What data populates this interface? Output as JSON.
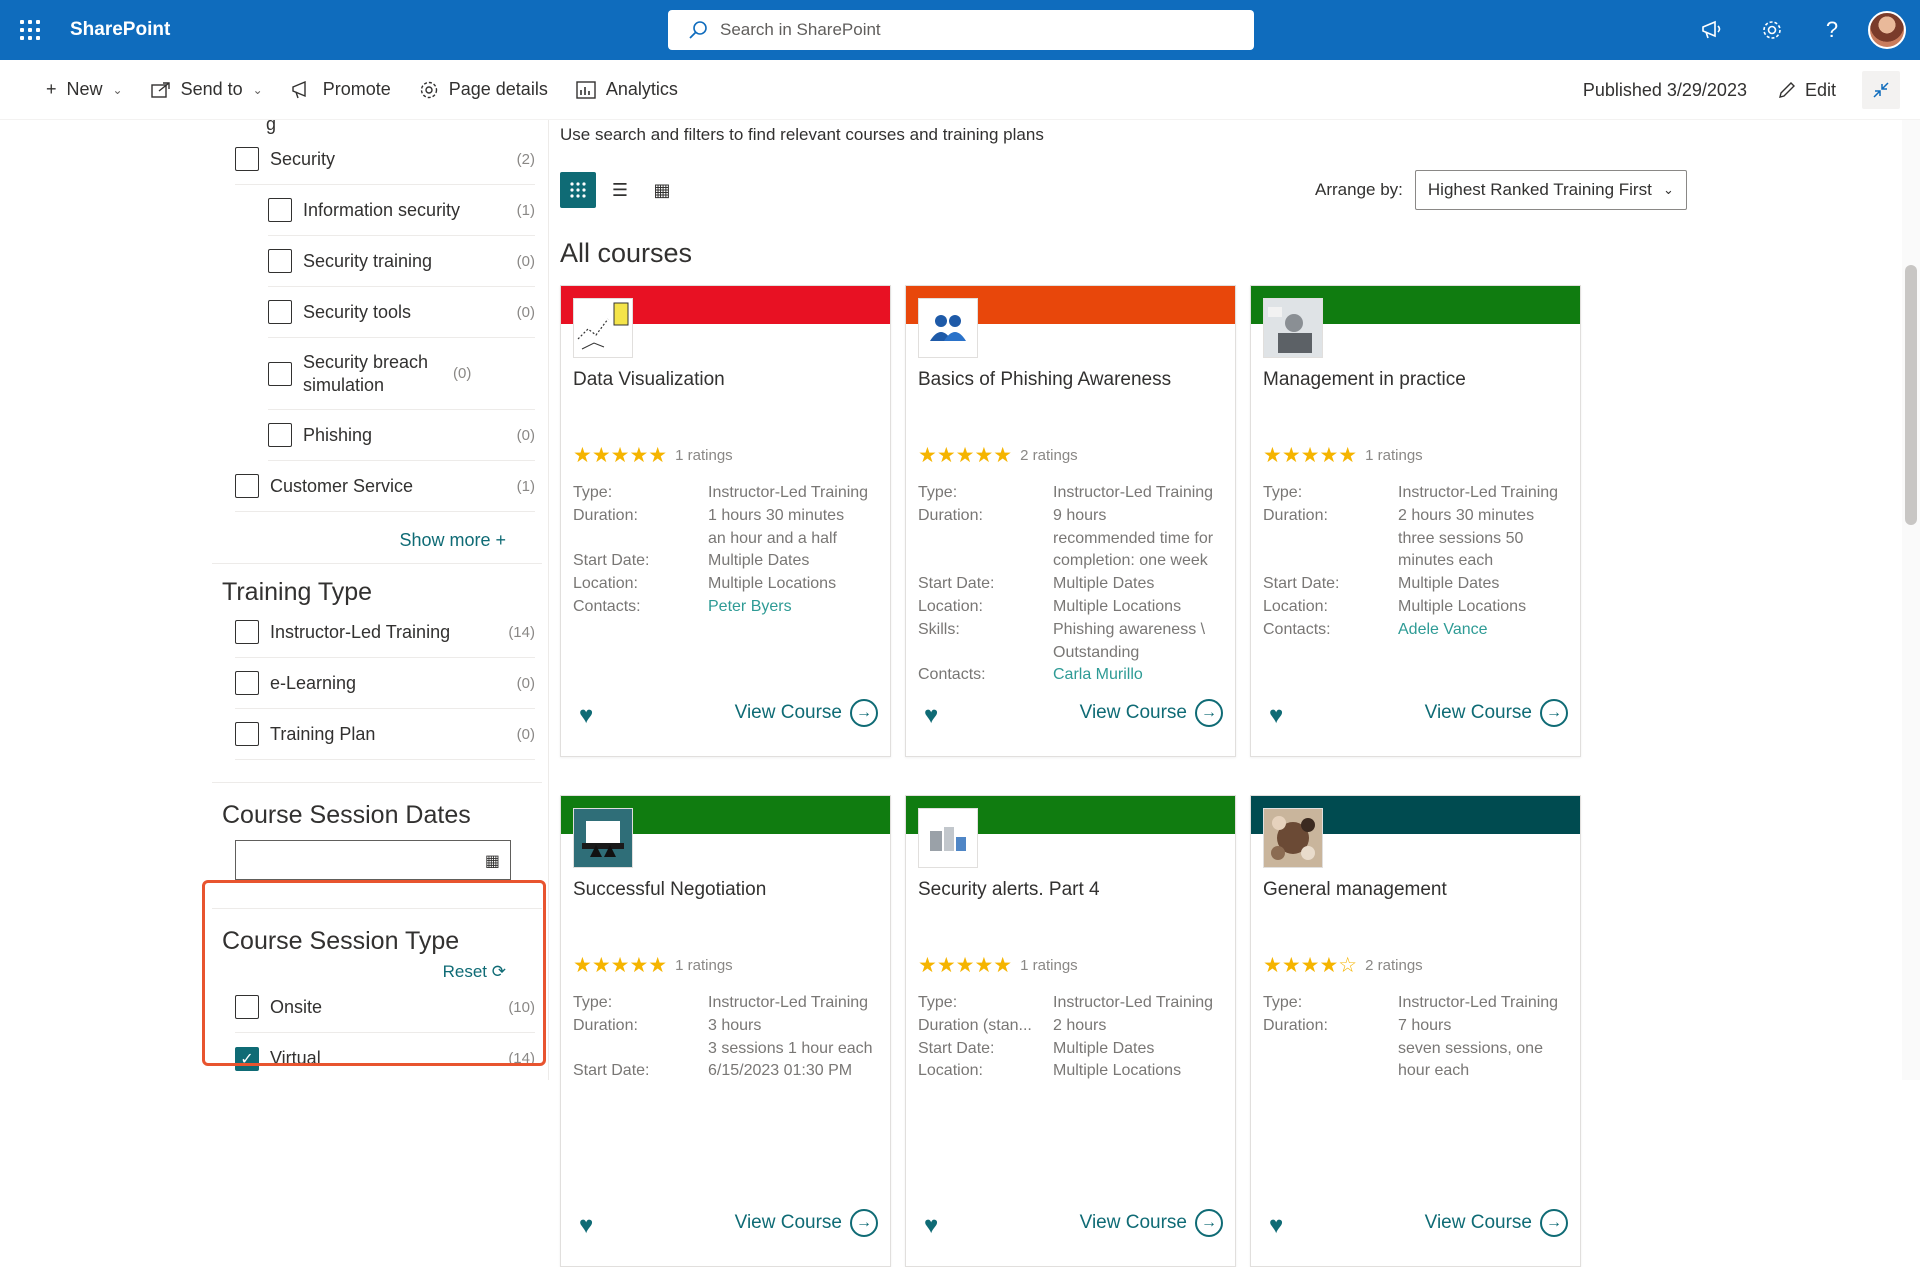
{
  "suite": {
    "app_name": "SharePoint",
    "search_placeholder": "Search in SharePoint"
  },
  "command_bar": {
    "new": "New",
    "send_to": "Send to",
    "promote": "Promote",
    "page_details": "Page details",
    "analytics": "Analytics",
    "published": "Published 3/29/2023",
    "edit": "Edit"
  },
  "filters": {
    "partial_top_header": "g",
    "category_items": [
      {
        "label": "Security",
        "count": "(2)",
        "level": 0
      },
      {
        "label": "Information security",
        "count": "(1)",
        "level": 1
      },
      {
        "label": "Security training",
        "count": "(0)",
        "level": 1
      },
      {
        "label": "Security tools",
        "count": "(0)",
        "level": 1
      },
      {
        "label": "Security breach simulation",
        "count": "(0)",
        "level": 1
      },
      {
        "label": "Phishing",
        "count": "(0)",
        "level": 1
      },
      {
        "label": "Customer Service",
        "count": "(1)",
        "level": 0
      }
    ],
    "show_more": "Show more",
    "training_type": {
      "header": "Training Type",
      "items": [
        {
          "label": "Instructor-Led Training",
          "count": "(14)"
        },
        {
          "label": "e-Learning",
          "count": "(0)"
        },
        {
          "label": "Training Plan",
          "count": "(0)"
        }
      ]
    },
    "session_dates": {
      "header": "Course Session Dates",
      "value": ""
    },
    "session_type": {
      "header": "Course Session Type",
      "reset": "Reset",
      "items": [
        {
          "label": "Onsite",
          "count": "(10)",
          "checked": false
        },
        {
          "label": "Virtual",
          "count": "(14)",
          "checked": true
        }
      ]
    }
  },
  "main": {
    "intro": "Use search and filters to find relevant courses and training plans",
    "arrange_label": "Arrange by:",
    "arrange_value": "Highest Ranked Training First",
    "section_title": "All courses",
    "view_course_label": "View Course",
    "courses": [
      {
        "title": "Data Visualization",
        "band_color": "#e81123",
        "thumb_icon": "data-visualization-thumbnail",
        "stars": "★★★★★",
        "rating_text": "1 ratings",
        "meta": [
          {
            "k": "Type:",
            "v": "Instructor-Led Training"
          },
          {
            "k": "Duration:",
            "v": "1 hours 30 minutes"
          },
          {
            "k": "",
            "v": "an hour and a half"
          },
          {
            "k": "Start Date:",
            "v": "Multiple Dates"
          },
          {
            "k": "Location:",
            "v": "Multiple Locations"
          },
          {
            "k": "Contacts:",
            "v": "Peter Byers",
            "link": true
          }
        ]
      },
      {
        "title": "Basics of Phishing Awareness",
        "band_color": "#e8470b",
        "thumb_icon": "people-icon",
        "stars": "★★★★★",
        "rating_text": "2 ratings",
        "meta": [
          {
            "k": "Type:",
            "v": "Instructor-Led Training"
          },
          {
            "k": "Duration:",
            "v": "9 hours"
          },
          {
            "k": "",
            "v": "recommended time for"
          },
          {
            "k": "",
            "v": "completion: one week"
          },
          {
            "k": "Start Date:",
            "v": "Multiple Dates"
          },
          {
            "k": "Location:",
            "v": "Multiple Locations"
          },
          {
            "k": "Skills:",
            "v": "Phishing awareness \\"
          },
          {
            "k": "",
            "v": "Outstanding"
          },
          {
            "k": "Contacts:",
            "v": "Carla Murillo",
            "link": true
          }
        ]
      },
      {
        "title": "Management in practice",
        "band_color": "#107c10",
        "thumb_icon": "photo-thumbnail",
        "stars": "★★★★★",
        "rating_text": "1 ratings",
        "meta": [
          {
            "k": "Type:",
            "v": "Instructor-Led Training"
          },
          {
            "k": "Duration:",
            "v": "2 hours 30 minutes"
          },
          {
            "k": "",
            "v": "three sessions 50"
          },
          {
            "k": "",
            "v": "minutes each"
          },
          {
            "k": "Start Date:",
            "v": "Multiple Dates"
          },
          {
            "k": "Location:",
            "v": "Multiple Locations"
          },
          {
            "k": "Contacts:",
            "v": "Adele Vance",
            "link": true
          }
        ]
      },
      {
        "title": "Successful Negotiation",
        "band_color": "#107c10",
        "thumb_icon": "laptop-thumbnail",
        "stars": "★★★★★",
        "rating_text": "1 ratings",
        "meta": [
          {
            "k": "Type:",
            "v": "Instructor-Led Training"
          },
          {
            "k": "Duration:",
            "v": "3 hours"
          },
          {
            "k": "",
            "v": "3 sessions 1 hour each"
          },
          {
            "k": "Start Date:",
            "v": "6/15/2023 01:30 PM"
          }
        ]
      },
      {
        "title": "Security alerts. Part 4",
        "band_color": "#107c10",
        "thumb_icon": "building-thumbnail",
        "stars": "★★★★★",
        "rating_text": "1 ratings",
        "meta": [
          {
            "k": "Type:",
            "v": "Instructor-Led Training"
          },
          {
            "k": "Duration (stan...",
            "v": "2 hours"
          },
          {
            "k": "Start Date:",
            "v": "Multiple Dates"
          },
          {
            "k": "Location:",
            "v": "Multiple Locations"
          }
        ]
      },
      {
        "title": "General management",
        "band_color": "#004b50",
        "thumb_icon": "team-photo-thumbnail",
        "stars": "★★★★☆",
        "rating_text": "2 ratings",
        "meta": [
          {
            "k": "Type:",
            "v": "Instructor-Led Training"
          },
          {
            "k": "Duration:",
            "v": "7 hours"
          },
          {
            "k": "",
            "v": "seven sessions, one"
          },
          {
            "k": "",
            "v": "hour each"
          }
        ]
      }
    ]
  }
}
